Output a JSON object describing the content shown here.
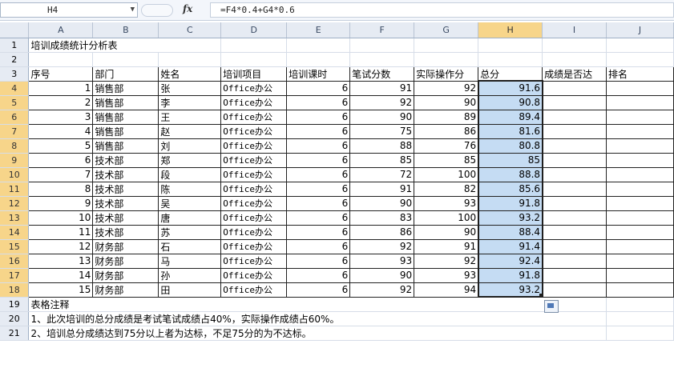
{
  "formula_bar": {
    "cell_ref": "H4",
    "fx_label": "fx",
    "formula": "=F4*0.4+G4*0.6"
  },
  "columns": [
    "A",
    "B",
    "C",
    "D",
    "E",
    "F",
    "G",
    "H",
    "I",
    "J"
  ],
  "selected_column": "H",
  "title": "培训成绩统计分析表",
  "headers": [
    "序号",
    "部门",
    "姓名",
    "培训项目",
    "培训课时",
    "笔试分数",
    "实际操作分",
    "总分",
    "成绩是否达",
    "排名"
  ],
  "rows": [
    [
      "1",
      "销售部",
      "张",
      "Office办公",
      "6",
      "91",
      "92",
      "91.6"
    ],
    [
      "2",
      "销售部",
      "李",
      "Office办公",
      "6",
      "92",
      "90",
      "90.8"
    ],
    [
      "3",
      "销售部",
      "王",
      "Office办公",
      "6",
      "90",
      "89",
      "89.4"
    ],
    [
      "4",
      "销售部",
      "赵",
      "Office办公",
      "6",
      "75",
      "86",
      "81.6"
    ],
    [
      "5",
      "销售部",
      "刘",
      "Office办公",
      "6",
      "88",
      "76",
      "80.8"
    ],
    [
      "6",
      "技术部",
      "郑",
      "Office办公",
      "6",
      "85",
      "85",
      "85"
    ],
    [
      "7",
      "技术部",
      "段",
      "Office办公",
      "6",
      "72",
      "100",
      "88.8"
    ],
    [
      "8",
      "技术部",
      "陈",
      "Office办公",
      "6",
      "91",
      "82",
      "85.6"
    ],
    [
      "9",
      "技术部",
      "吴",
      "Office办公",
      "6",
      "90",
      "93",
      "91.8"
    ],
    [
      "10",
      "技术部",
      "唐",
      "Office办公",
      "6",
      "83",
      "100",
      "93.2"
    ],
    [
      "11",
      "技术部",
      "苏",
      "Office办公",
      "6",
      "86",
      "90",
      "88.4"
    ],
    [
      "12",
      "财务部",
      "石",
      "Office办公",
      "6",
      "92",
      "91",
      "91.4"
    ],
    [
      "13",
      "财务部",
      "马",
      "Office办公",
      "6",
      "93",
      "92",
      "92.4"
    ],
    [
      "14",
      "财务部",
      "孙",
      "Office办公",
      "6",
      "90",
      "93",
      "91.8"
    ],
    [
      "15",
      "财务部",
      "田",
      "Office办公",
      "6",
      "92",
      "94",
      "93.2"
    ]
  ],
  "notes": {
    "title": "表格注释",
    "line1": "1、此次培训的总分成绩是考试笔试成绩占40%，实际操作成绩占60%。",
    "line2": "2、培训总分成绩达到75分以上者为达标，不足75分的为不达标。"
  },
  "colors": {
    "selection": "#c5dcf3",
    "header_selected": "#f7d58a"
  }
}
